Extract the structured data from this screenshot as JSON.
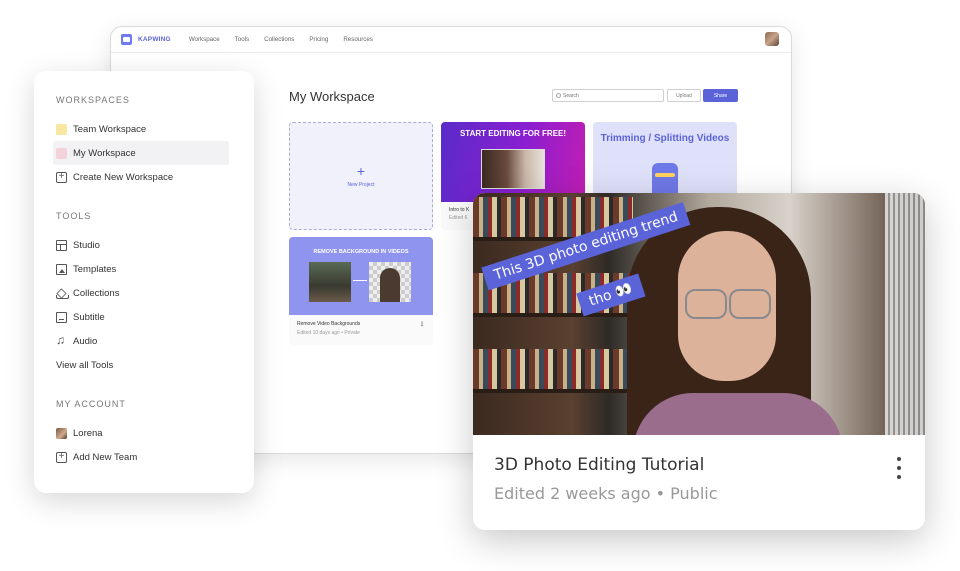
{
  "app": {
    "brand": "KAPWING",
    "nav": [
      "Workspace",
      "Tools",
      "Collections",
      "Pricing",
      "Resources"
    ]
  },
  "workspace": {
    "title": "My Workspace",
    "search_placeholder": "Search",
    "upload_label": "Upload",
    "share_label": "Share",
    "new_project_label": "New Project",
    "cards": [
      {
        "thumb_title": "START EDITING FOR FREE!",
        "caption": "Intro to K",
        "meta": "Edited 6"
      },
      {
        "thumb_title": "Trimming / Splitting Videos"
      },
      {
        "thumb_title": "REMOVE BACKGROUND IN VIDEOS",
        "caption": "Remove Video Backgrounds",
        "meta": "Edited 10 days ago  •  Private"
      }
    ]
  },
  "sidebar": {
    "workspaces_heading": "WORKSPACES",
    "workspaces": [
      "Team Workspace",
      "My Workspace",
      "Create New Workspace"
    ],
    "tools_heading": "TOOLS",
    "tools": [
      "Studio",
      "Templates",
      "Collections",
      "Subtitle",
      "Audio"
    ],
    "view_all": "View all Tools",
    "account_heading": "MY ACCOUNT",
    "account": [
      "Lorena",
      "Add New Team"
    ]
  },
  "feature": {
    "banner_line1": "This 3D photo editing trend",
    "banner_line2": "tho 👀",
    "title": "3D Photo Editing Tutorial",
    "meta": "Edited 2 weeks ago  •  Public"
  },
  "colors": {
    "accent": "#5b63d9",
    "sidebar_active": "#f2f2f4"
  }
}
